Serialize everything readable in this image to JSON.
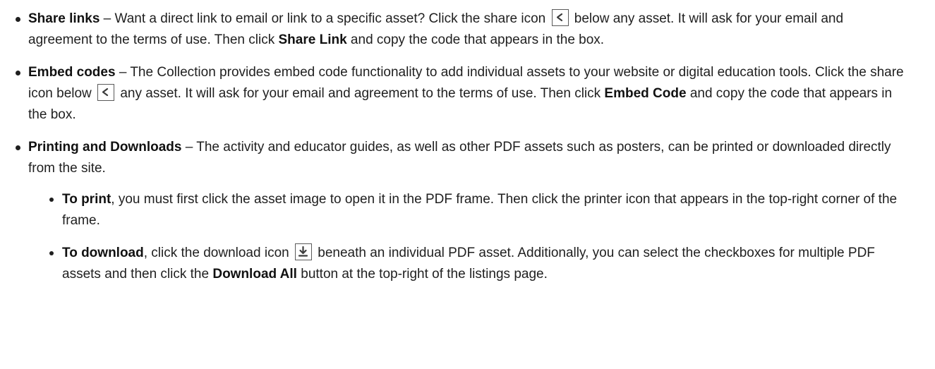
{
  "items": {
    "share": {
      "title": "Share links",
      "text1": " – Want a direct link to email or link to a specific asset? Click the share icon ",
      "text2": " below any asset. It will ask for your email and agreement to the terms of use. Then click ",
      "bold2": "Share Link",
      "text3": " and copy the code that appears in the box."
    },
    "embed": {
      "title": "Embed codes",
      "text1": " – The Collection provides embed code functionality to add individual assets to your website or digital education tools. Click the share icon below ",
      "text2": " any asset. It will ask for your email and agreement to the terms of use. Then click ",
      "bold2": "Embed Code",
      "text3": " and copy the code that appears in the box."
    },
    "printing": {
      "title": "Printing and Downloads",
      "text1": " – The activity and educator guides, as well as other PDF assets such as posters, can be printed or downloaded directly from the site.",
      "print": {
        "title": "To print",
        "text1": ", you must first click the asset image to open it in the PDF frame. Then click the printer icon that appears in the top-right corner of the frame."
      },
      "download": {
        "title": "To download",
        "text1": ", click the download icon ",
        "text2": " beneath an individual PDF asset. Additionally, you can select the checkboxes for multiple PDF assets and then click the ",
        "bold2": "Download All",
        "text3": " button at the top-right of the listings page."
      }
    }
  },
  "icons": {
    "share": "share-icon",
    "download": "download-icon"
  }
}
